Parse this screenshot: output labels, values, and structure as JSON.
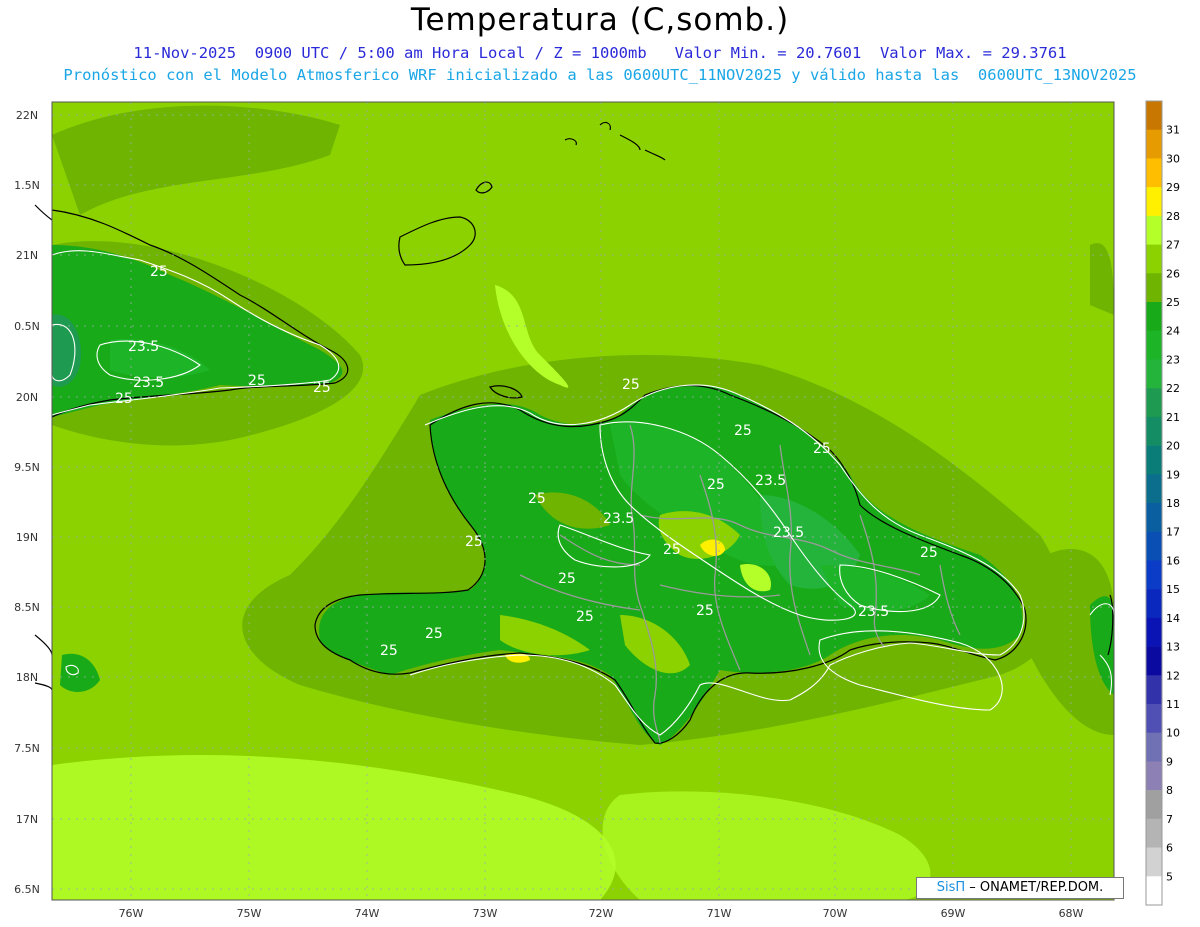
{
  "title": "Temperatura (C,somb.)",
  "subtitle_line1": "11-Nov-2025  0900 UTC / 5:00 am Hora Local / Z = 1000mb   Valor Min. = 20.7601  Valor Max. = 29.3761",
  "subtitle_line2": "Pronóstico con el Modelo Atmosferico WRF inicializado a las 0600UTC_11NOV2025 y válido hasta las  0600UTC_13NOV2025",
  "credit": {
    "brand": "SisΠ",
    "text": "– ONAMET/REP.DOM."
  },
  "lat_ticks": [
    "22N",
    "1.5N",
    "21N",
    "0.5N",
    "20N",
    "9.5N",
    "19N",
    "8.5N",
    "18N",
    "7.5N",
    "17N",
    "6.5N"
  ],
  "lon_ticks": [
    "76W",
    "75W",
    "74W",
    "73W",
    "72W",
    "71W",
    "70W",
    "69W",
    "68W"
  ],
  "contour_labels": [
    "25",
    "23.5",
    "23.5",
    "25",
    "25",
    "25",
    "25",
    "25",
    "25",
    "25",
    "23.5",
    "25",
    "23.5",
    "23.5",
    "25",
    "25",
    "25",
    "25",
    "25",
    "23.5",
    "25",
    "25",
    "25"
  ],
  "colorbar": {
    "levels": [
      "31",
      "30",
      "29",
      "28",
      "27",
      "26",
      "25",
      "24",
      "23",
      "22",
      "21",
      "20",
      "19",
      "18",
      "17",
      "16",
      "15",
      "14",
      "13",
      "12",
      "11",
      "10",
      "9",
      "8",
      "7",
      "6",
      "5"
    ],
    "colors": [
      "#c87800",
      "#e69b00",
      "#ffbe00",
      "#fff000",
      "#b4ff2a",
      "#8cd200",
      "#6eb400",
      "#18aa18",
      "#1eb428",
      "#24b43c",
      "#1e9b50",
      "#148c64",
      "#0a7d78",
      "#0a6e8c",
      "#0a5fa0",
      "#0a50b4",
      "#0a3cc8",
      "#0a28be",
      "#0a14b4",
      "#0a0aa0",
      "#3232aa",
      "#5050b4",
      "#7070b4",
      "#8c80b4",
      "#a0a0a0",
      "#b4b4b4",
      "#d2d2d2",
      "#ffffff"
    ]
  },
  "field_colors": {
    "t26": "#6eb400",
    "t25": "#8cd200",
    "t24": "#6eb400",
    "t23": "#18aa18",
    "t22": "#1e9b50",
    "t27": "#b4ff2a",
    "t28": "#fff000"
  }
}
